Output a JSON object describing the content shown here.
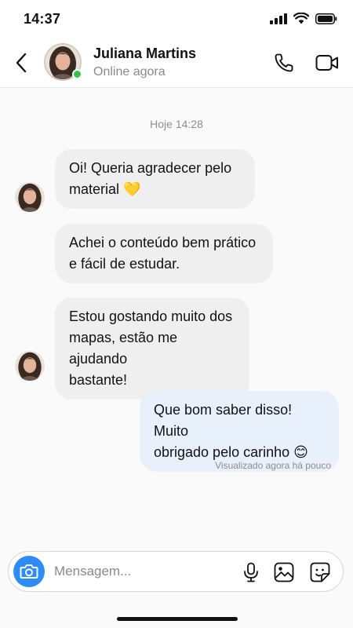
{
  "status_bar": {
    "time": "14:37"
  },
  "header": {
    "contact_name": "Juliana Martins",
    "contact_status": "Online agora",
    "online_color": "#33c24a"
  },
  "chat": {
    "date_separator": "Hoje 14:28",
    "messages": [
      {
        "direction": "incoming",
        "text": "Oi! Queria agradecer pelo\nmaterial 💛"
      },
      {
        "direction": "incoming",
        "text": "Achei o conteúdo bem prático\ne fácil de estudar."
      },
      {
        "direction": "incoming",
        "text": "Estou gostando muito dos\nmapas, estão me ajudando\nbastante!"
      },
      {
        "direction": "outgoing",
        "text": "Que bom saber disso! Muito\nobrigado pelo carinho 😊"
      }
    ],
    "seen_status": "Visualizado agora há pouco"
  },
  "composer": {
    "placeholder": "Mensagem...",
    "accent_color": "#2f8cf5"
  },
  "icons": [
    "back-arrow-icon",
    "phone-icon",
    "video-camera-icon",
    "camera-icon",
    "microphone-icon",
    "gallery-icon",
    "sticker-icon"
  ]
}
